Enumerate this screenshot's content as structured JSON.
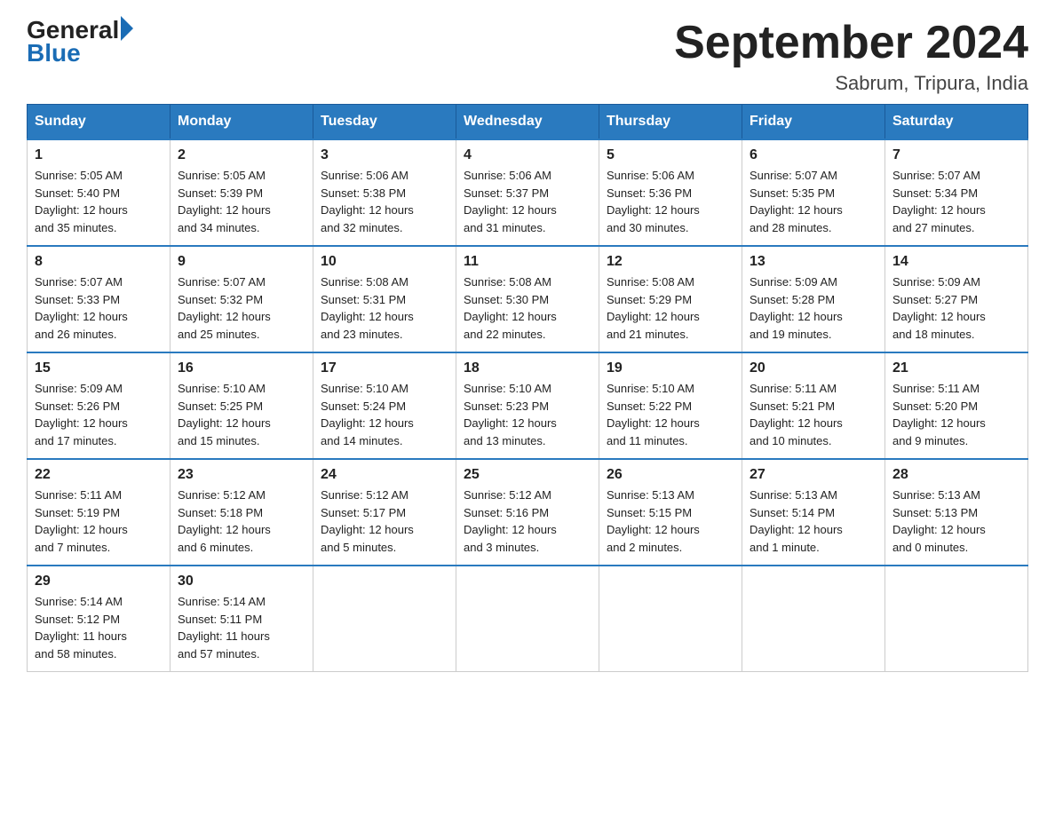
{
  "header": {
    "logo": {
      "general": "General",
      "blue": "Blue",
      "arrow": "▶"
    },
    "title": "September 2024",
    "location": "Sabrum, Tripura, India"
  },
  "days_of_week": [
    "Sunday",
    "Monday",
    "Tuesday",
    "Wednesday",
    "Thursday",
    "Friday",
    "Saturday"
  ],
  "weeks": [
    [
      {
        "day": "1",
        "sunrise": "5:05 AM",
        "sunset": "5:40 PM",
        "daylight": "12 hours and 35 minutes."
      },
      {
        "day": "2",
        "sunrise": "5:05 AM",
        "sunset": "5:39 PM",
        "daylight": "12 hours and 34 minutes."
      },
      {
        "day": "3",
        "sunrise": "5:06 AM",
        "sunset": "5:38 PM",
        "daylight": "12 hours and 32 minutes."
      },
      {
        "day": "4",
        "sunrise": "5:06 AM",
        "sunset": "5:37 PM",
        "daylight": "12 hours and 31 minutes."
      },
      {
        "day": "5",
        "sunrise": "5:06 AM",
        "sunset": "5:36 PM",
        "daylight": "12 hours and 30 minutes."
      },
      {
        "day": "6",
        "sunrise": "5:07 AM",
        "sunset": "5:35 PM",
        "daylight": "12 hours and 28 minutes."
      },
      {
        "day": "7",
        "sunrise": "5:07 AM",
        "sunset": "5:34 PM",
        "daylight": "12 hours and 27 minutes."
      }
    ],
    [
      {
        "day": "8",
        "sunrise": "5:07 AM",
        "sunset": "5:33 PM",
        "daylight": "12 hours and 26 minutes."
      },
      {
        "day": "9",
        "sunrise": "5:07 AM",
        "sunset": "5:32 PM",
        "daylight": "12 hours and 25 minutes."
      },
      {
        "day": "10",
        "sunrise": "5:08 AM",
        "sunset": "5:31 PM",
        "daylight": "12 hours and 23 minutes."
      },
      {
        "day": "11",
        "sunrise": "5:08 AM",
        "sunset": "5:30 PM",
        "daylight": "12 hours and 22 minutes."
      },
      {
        "day": "12",
        "sunrise": "5:08 AM",
        "sunset": "5:29 PM",
        "daylight": "12 hours and 21 minutes."
      },
      {
        "day": "13",
        "sunrise": "5:09 AM",
        "sunset": "5:28 PM",
        "daylight": "12 hours and 19 minutes."
      },
      {
        "day": "14",
        "sunrise": "5:09 AM",
        "sunset": "5:27 PM",
        "daylight": "12 hours and 18 minutes."
      }
    ],
    [
      {
        "day": "15",
        "sunrise": "5:09 AM",
        "sunset": "5:26 PM",
        "daylight": "12 hours and 17 minutes."
      },
      {
        "day": "16",
        "sunrise": "5:10 AM",
        "sunset": "5:25 PM",
        "daylight": "12 hours and 15 minutes."
      },
      {
        "day": "17",
        "sunrise": "5:10 AM",
        "sunset": "5:24 PM",
        "daylight": "12 hours and 14 minutes."
      },
      {
        "day": "18",
        "sunrise": "5:10 AM",
        "sunset": "5:23 PM",
        "daylight": "12 hours and 13 minutes."
      },
      {
        "day": "19",
        "sunrise": "5:10 AM",
        "sunset": "5:22 PM",
        "daylight": "12 hours and 11 minutes."
      },
      {
        "day": "20",
        "sunrise": "5:11 AM",
        "sunset": "5:21 PM",
        "daylight": "12 hours and 10 minutes."
      },
      {
        "day": "21",
        "sunrise": "5:11 AM",
        "sunset": "5:20 PM",
        "daylight": "12 hours and 9 minutes."
      }
    ],
    [
      {
        "day": "22",
        "sunrise": "5:11 AM",
        "sunset": "5:19 PM",
        "daylight": "12 hours and 7 minutes."
      },
      {
        "day": "23",
        "sunrise": "5:12 AM",
        "sunset": "5:18 PM",
        "daylight": "12 hours and 6 minutes."
      },
      {
        "day": "24",
        "sunrise": "5:12 AM",
        "sunset": "5:17 PM",
        "daylight": "12 hours and 5 minutes."
      },
      {
        "day": "25",
        "sunrise": "5:12 AM",
        "sunset": "5:16 PM",
        "daylight": "12 hours and 3 minutes."
      },
      {
        "day": "26",
        "sunrise": "5:13 AM",
        "sunset": "5:15 PM",
        "daylight": "12 hours and 2 minutes."
      },
      {
        "day": "27",
        "sunrise": "5:13 AM",
        "sunset": "5:14 PM",
        "daylight": "12 hours and 1 minute."
      },
      {
        "day": "28",
        "sunrise": "5:13 AM",
        "sunset": "5:13 PM",
        "daylight": "12 hours and 0 minutes."
      }
    ],
    [
      {
        "day": "29",
        "sunrise": "5:14 AM",
        "sunset": "5:12 PM",
        "daylight": "11 hours and 58 minutes."
      },
      {
        "day": "30",
        "sunrise": "5:14 AM",
        "sunset": "5:11 PM",
        "daylight": "11 hours and 57 minutes."
      },
      null,
      null,
      null,
      null,
      null
    ]
  ],
  "labels": {
    "sunrise": "Sunrise:",
    "sunset": "Sunset:",
    "daylight": "Daylight:"
  }
}
